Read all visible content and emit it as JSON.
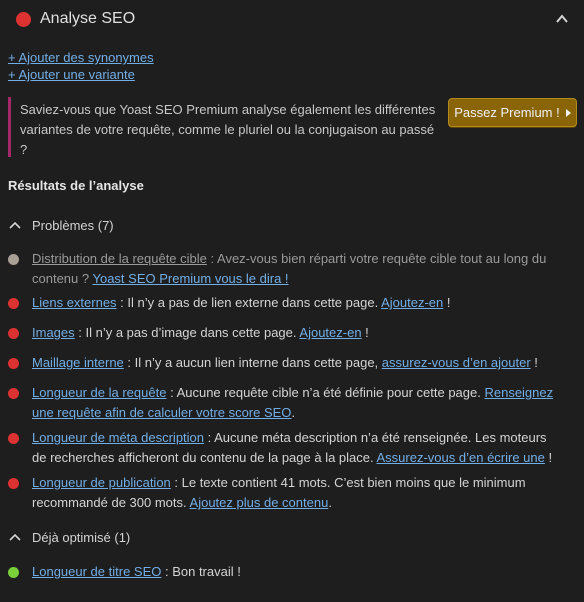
{
  "header": {
    "title": "Analyse SEO"
  },
  "links": {
    "synonyms": "+ Ajouter des synonymes",
    "variant": "+ Ajouter une variante"
  },
  "promo": {
    "text": "Saviez-vous que Yoast SEO Premium analyse également les différentes variantes de votre requête, comme le pluriel ou la conjugaison au passé ?",
    "button": "Passez Premium !"
  },
  "results": {
    "title": "Résultats de l’analyse",
    "problems_label": "Problèmes (7)",
    "optimized_label": "Déjà optimisé (1)",
    "problems": [
      {
        "link": "Distribution de la requête cible",
        "text": " : Avez-vous bien réparti votre requête cible tout au long du contenu ? ",
        "action": "Yoast SEO Premium vous le dira !",
        "end": ""
      },
      {
        "link": "Liens externes",
        "text": " : Il n’y a pas de lien externe dans cette page. ",
        "action": "Ajoutez-en",
        "end": " !"
      },
      {
        "link": "Images",
        "text": " : Il n’y a pas d’image dans cette page. ",
        "action": "Ajoutez-en",
        "end": " !"
      },
      {
        "link": "Maillage interne",
        "text": " : Il n’y a aucun lien interne dans cette page, ",
        "action": "assurez-vous d’en ajouter",
        "end": " !"
      },
      {
        "link": "Longueur de la requête",
        "text": " : Aucune requête cible n’a été définie pour cette page. ",
        "action": "Renseignez une requête afin de calculer votre score SEO",
        "end": "."
      },
      {
        "link": "Longueur de méta description",
        "text": " : Aucune méta description n’a été renseignée. Les moteurs de recherches afficheront du contenu de la page à la place. ",
        "action": "Assurez-vous d’en écrire une",
        "end": " !"
      },
      {
        "link": "Longueur de publication",
        "text": " : Le texte contient 41 mots. C’est bien moins que le minimum recommandé de 300 mots. ",
        "action": "Ajoutez plus de contenu",
        "end": "."
      }
    ],
    "good": [
      {
        "link": "Longueur de titre SEO",
        "text": " : Bon travail !"
      }
    ]
  },
  "colors": {
    "problem": "#dc3232",
    "good": "#7ad03a",
    "premium": "#a89f95",
    "link": "#72aee6",
    "button": "#8a6508"
  }
}
